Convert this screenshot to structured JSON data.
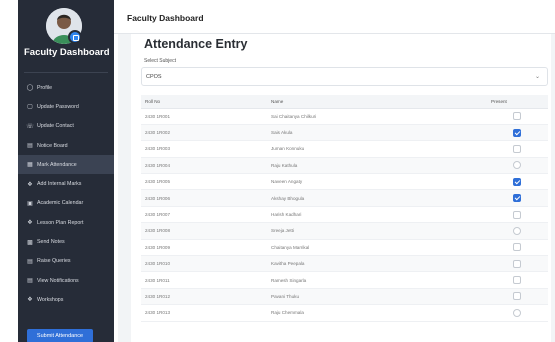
{
  "sidebar": {
    "title": "Faculty Dashboard",
    "items": [
      {
        "label": "Profile",
        "icon": "user-circle-icon"
      },
      {
        "label": "Update Password",
        "icon": "lock-icon"
      },
      {
        "label": "Update Contact",
        "icon": "phone-icon"
      },
      {
        "label": "Notice Board",
        "icon": "clipboard-icon"
      },
      {
        "label": "Mark Attendance",
        "icon": "checklist-icon",
        "active": true
      },
      {
        "label": "Add Internal Marks",
        "icon": "edit-icon"
      },
      {
        "label": "Academic Calendar",
        "icon": "calendar-icon"
      },
      {
        "label": "Lesson Plan Report",
        "icon": "report-icon"
      },
      {
        "label": "Send Notes",
        "icon": "notes-icon"
      },
      {
        "label": "Raise Queries",
        "icon": "question-icon"
      },
      {
        "label": "View Notifications",
        "icon": "bell-icon"
      },
      {
        "label": "Workshops",
        "icon": "workshop-icon"
      }
    ]
  },
  "header": {
    "title": "Faculty Dashboard"
  },
  "main": {
    "title": "Attendance Entry",
    "select_label": "Select Subject",
    "selected_subject": "CPOS",
    "table": {
      "headers": [
        "Roll No",
        "Name",
        "Present"
      ],
      "rows": [
        {
          "roll": "2430 1R001",
          "name": "Sai Chaitanya Chilkuri",
          "present": false,
          "control": "square"
        },
        {
          "roll": "2430 1R002",
          "name": "Sais Akula",
          "present": true,
          "control": "square"
        },
        {
          "roll": "2430 1R003",
          "name": "Juman Konnuku",
          "present": false,
          "control": "square"
        },
        {
          "roll": "2430 1R004",
          "name": "Raju Kathula",
          "present": false,
          "control": "round"
        },
        {
          "roll": "2430 1R005",
          "name": "Naveen Angaty",
          "present": true,
          "control": "square"
        },
        {
          "roll": "2430 1R006",
          "name": "Akshay Bhogula",
          "present": true,
          "control": "square"
        },
        {
          "roll": "2430 1R007",
          "name": "Harish Kadhari",
          "present": false,
          "control": "square"
        },
        {
          "roll": "2430 1R008",
          "name": "Sreeja Jetti",
          "present": false,
          "control": "round"
        },
        {
          "roll": "2430 1R009",
          "name": "Chaitanya Marrikal",
          "present": false,
          "control": "square"
        },
        {
          "roll": "2430 1R010",
          "name": "Kavitha Peepala",
          "present": false,
          "control": "square"
        },
        {
          "roll": "2430 1R011",
          "name": "Ramesh Singarla",
          "present": false,
          "control": "square"
        },
        {
          "roll": "2430 1R012",
          "name": "Pavani Thuku",
          "present": false,
          "control": "square"
        },
        {
          "roll": "2430 1R013",
          "name": "Raju Chemmala",
          "present": false,
          "control": "round"
        }
      ]
    },
    "submit_label": "Submit Attendance"
  },
  "colors": {
    "sidebar_bg": "#262c38",
    "sidebar_active": "#3b4353",
    "accent": "#2f6fd8"
  }
}
